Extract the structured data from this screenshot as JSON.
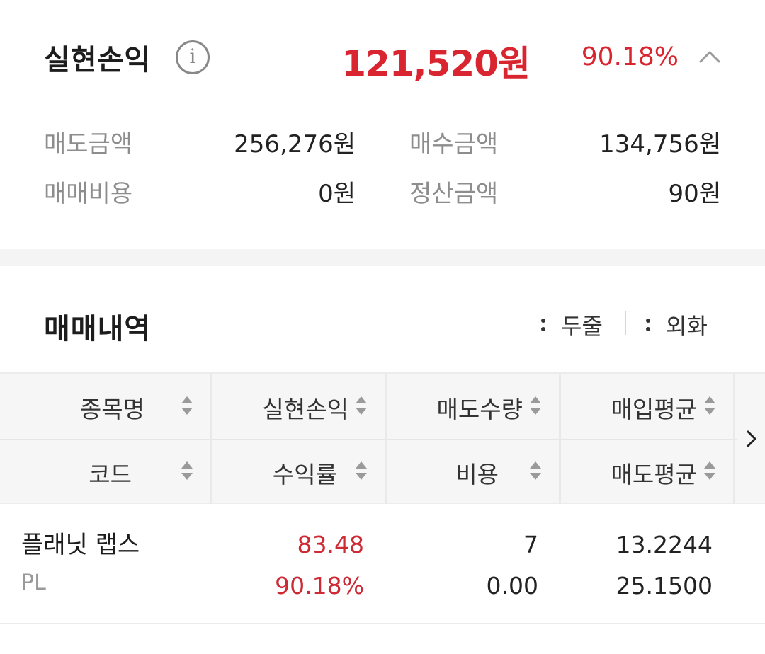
{
  "summary": {
    "title": "실현손익",
    "info_icon": "info-circle-icon",
    "total_amount": "121,520원",
    "total_rate": "90.18%",
    "collapse_icon": "chevron-up-icon",
    "sell_amount_label": "매도금액",
    "sell_amount_value": "256,276원",
    "buy_amount_label": "매수금액",
    "buy_amount_value": "134,756원",
    "fee_label": "매매비용",
    "fee_value": "0원",
    "settlement_label": "정산금액",
    "settlement_value": "90원"
  },
  "history": {
    "title": "매매내역",
    "option_two_lines": "두줄",
    "option_foreign": "외화",
    "headers": {
      "row1": [
        "종목명",
        "실현손익",
        "매도수량",
        "매입평균"
      ],
      "row2": [
        "코드",
        "수익률",
        "비용",
        "매도평균"
      ]
    },
    "rows": [
      {
        "name": "플래닛 랩스",
        "code": "PL",
        "profit": "83.48",
        "rate": "90.18%",
        "sell_qty": "7",
        "fee": "0.00",
        "buy_avg": "13.2244",
        "sell_avg": "25.1500"
      }
    ]
  },
  "colors": {
    "accent_red": "#d9252f",
    "label_gray": "#8d8d8d",
    "header_bg": "#f6f6f6"
  }
}
